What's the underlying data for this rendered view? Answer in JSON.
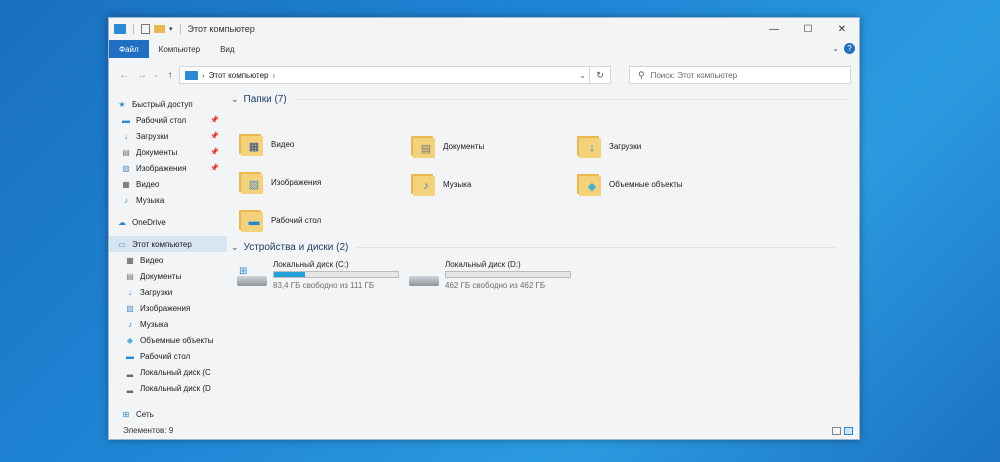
{
  "window": {
    "title": "Этот компьютер"
  },
  "ribbon": {
    "tabs": [
      "Файл",
      "Компьютер",
      "Вид"
    ]
  },
  "address": {
    "path": [
      "Этот компьютер"
    ],
    "search_placeholder": "Поиск: Этот компьютер"
  },
  "nav": {
    "items": [
      {
        "label": "Быстрый доступ",
        "icon": "star-icon",
        "pinned": false
      },
      {
        "label": "Рабочий стол",
        "icon": "desktop-icon",
        "pinned": true
      },
      {
        "label": "Загрузки",
        "icon": "download-icon",
        "pinned": true
      },
      {
        "label": "Документы",
        "icon": "document-icon",
        "pinned": true
      },
      {
        "label": "Изображения",
        "icon": "image-icon",
        "pinned": true
      },
      {
        "label": "Видео",
        "icon": "video-icon",
        "pinned": false
      },
      {
        "label": "Музыка",
        "icon": "music-icon",
        "pinned": false
      },
      {
        "label": "OneDrive",
        "icon": "cloud-icon",
        "pinned": false
      },
      {
        "label": "Этот компьютер",
        "icon": "computer-icon",
        "pinned": false
      },
      {
        "label": "Видео",
        "icon": "video-icon",
        "pinned": false
      },
      {
        "label": "Документы",
        "icon": "document-icon",
        "pinned": false
      },
      {
        "label": "Загрузки",
        "icon": "download-icon",
        "pinned": false
      },
      {
        "label": "Изображения",
        "icon": "image-icon",
        "pinned": false
      },
      {
        "label": "Музыка",
        "icon": "music-icon",
        "pinned": false
      },
      {
        "label": "Объемные объекты",
        "icon": "cube-icon",
        "pinned": false
      },
      {
        "label": "Рабочий стол",
        "icon": "desktop-icon",
        "pinned": false
      },
      {
        "label": "Локальный диск (C",
        "icon": "drive-icon",
        "pinned": false
      },
      {
        "label": "Локальный диск (D",
        "icon": "drive-icon",
        "pinned": false
      },
      {
        "label": "Сеть",
        "icon": "network-icon",
        "pinned": false
      }
    ]
  },
  "folders_section": {
    "title": "Папки (7)",
    "folders": [
      {
        "label": "Видео",
        "icon": "video-folder-icon"
      },
      {
        "label": "Документы",
        "icon": "documents-folder-icon"
      },
      {
        "label": "Загрузки",
        "icon": "downloads-folder-icon"
      },
      {
        "label": "Изображения",
        "icon": "pictures-folder-icon"
      },
      {
        "label": "Музыка",
        "icon": "music-folder-icon"
      },
      {
        "label": "Объемные объекты",
        "icon": "3d-objects-folder-icon"
      },
      {
        "label": "Рабочий стол",
        "icon": "desktop-folder-icon"
      }
    ]
  },
  "drives_section": {
    "title": "Устройства и диски (2)",
    "drives": [
      {
        "label": "Локальный диск (C:)",
        "free_text": "83,4 ГБ свободно из 111 ГБ",
        "used_fraction": 0.25
      },
      {
        "label": "Локальный диск (D:)",
        "free_text": "462 ГБ свободно из 462 ГБ",
        "used_fraction": 0.0
      }
    ]
  },
  "status": {
    "items_count": "Элементов: 9"
  },
  "colors": {
    "accent": "#1f6fc2",
    "bar_fill": "#26a0da"
  }
}
